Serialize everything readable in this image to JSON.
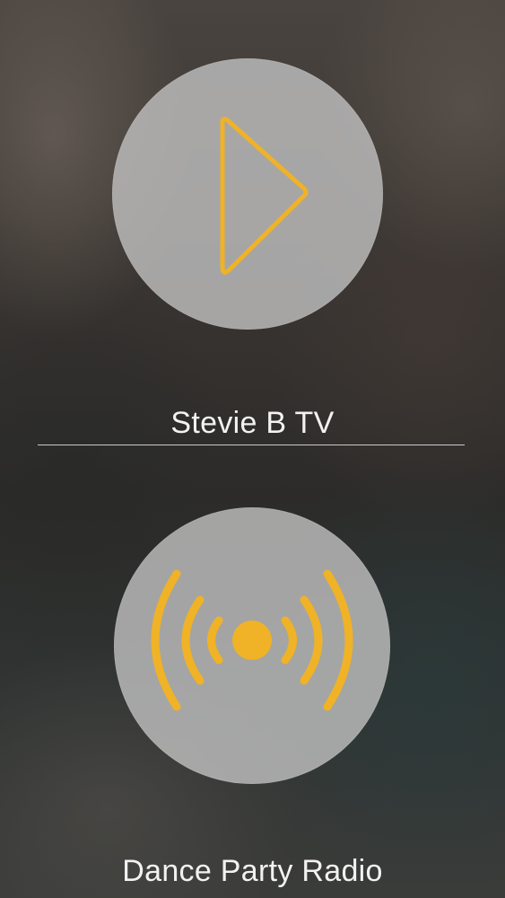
{
  "colors": {
    "accent": "#f0b226",
    "circle": "#bdbdbd",
    "text": "#f2f2f2",
    "divider": "#e6e6e6"
  },
  "channels": [
    {
      "label": "Stevie B TV",
      "icon": "play-icon"
    },
    {
      "label": "Dance Party Radio",
      "icon": "broadcast-icon"
    }
  ]
}
